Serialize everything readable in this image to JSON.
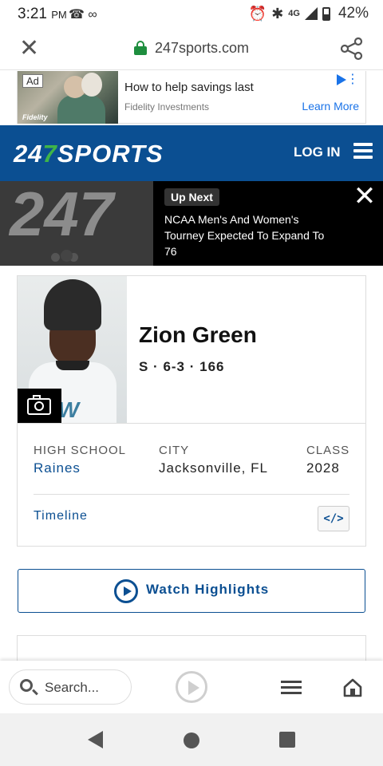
{
  "status_bar": {
    "time": "3:21",
    "ampm": "PM",
    "network": "4G",
    "battery_percent": "42%"
  },
  "browser": {
    "url": "247sports.com",
    "search_placeholder": "Search..."
  },
  "ad": {
    "badge": "Ad",
    "title": "How to help savings last",
    "advertiser": "Fidelity Investments",
    "cta": "Learn More",
    "image_logo": "Fidelity"
  },
  "header": {
    "logo_prefix": "24",
    "logo_seven": "7",
    "logo_suffix": "SPORTS",
    "login_label": "LOG IN"
  },
  "up_next": {
    "label": "Up Next",
    "headline": "NCAA Men's And Women's Tourney Expected To Expand To 76",
    "thumb_text": "247"
  },
  "player": {
    "name": "Zion Green",
    "meta": "S · 6-3 · 166",
    "photo_text": "AW",
    "fields": [
      {
        "label": "HIGH SCHOOL",
        "value": "Raines"
      },
      {
        "label": "CITY",
        "value": "Jacksonville, FL"
      },
      {
        "label": "CLASS",
        "value": "2028"
      }
    ],
    "timeline_label": "Timeline",
    "embed_label": "</>"
  },
  "highlights": {
    "label": "Watch Highlights"
  },
  "colors": {
    "brand_blue": "#0b4f92",
    "brand_green": "#3fb549",
    "link_blue": "#1a73e8"
  }
}
